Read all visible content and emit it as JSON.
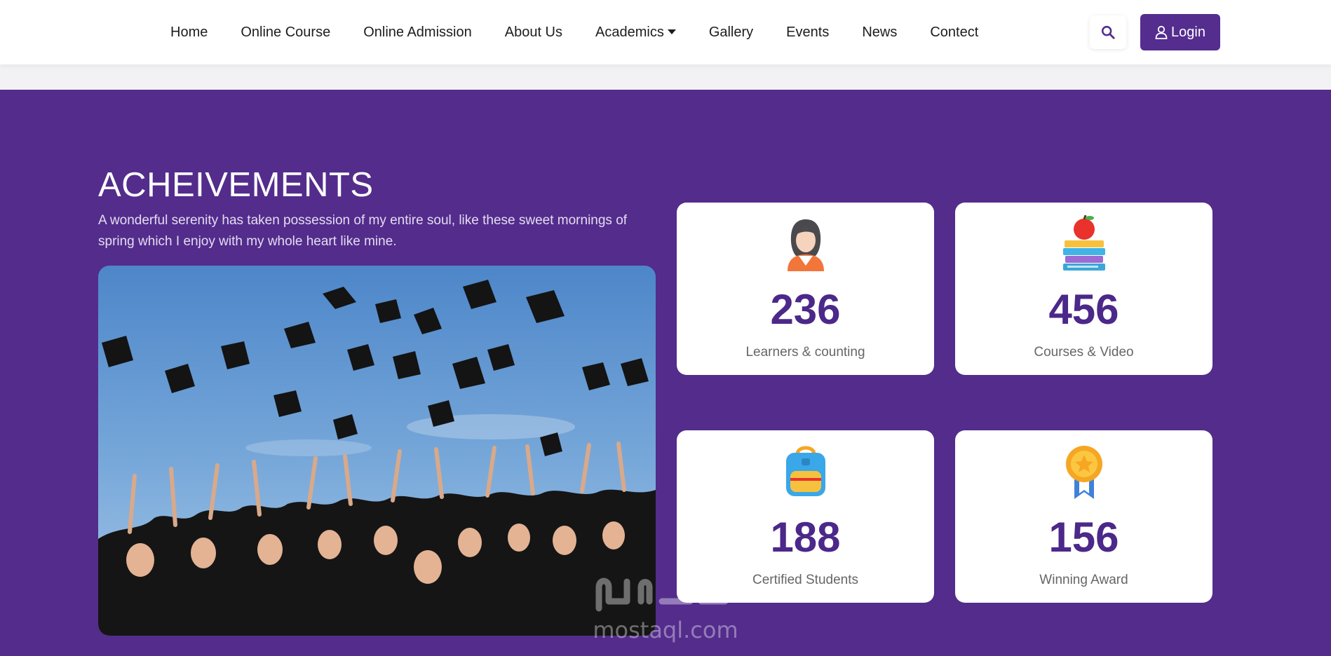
{
  "nav": {
    "links": [
      "Home",
      "Online Course",
      "Online Admission",
      "About Us",
      "Academics",
      "Gallery",
      "Events",
      "News",
      "Contect"
    ],
    "login_label": "Login"
  },
  "achievements": {
    "title": "ACHEIVEMENTS",
    "description": "A wonderful serenity has taken possession of my entire soul, like these sweet mornings of spring which I enjoy with my whole heart like mine.",
    "stats": [
      {
        "number": "236",
        "label": "Learners & counting",
        "icon": "learner-icon"
      },
      {
        "number": "456",
        "label": "Courses & Video",
        "icon": "books-apple-icon"
      },
      {
        "number": "188",
        "label": "Certified Students",
        "icon": "backpack-icon"
      },
      {
        "number": "156",
        "label": "Winning Award",
        "icon": "medal-icon"
      }
    ]
  },
  "watermark": {
    "text": "mostaql.com"
  },
  "colors": {
    "primary": "#532c8c",
    "accent_text": "#4b2889",
    "nav_bg": "#ffffff",
    "page_bg": "#f2f1f3"
  }
}
